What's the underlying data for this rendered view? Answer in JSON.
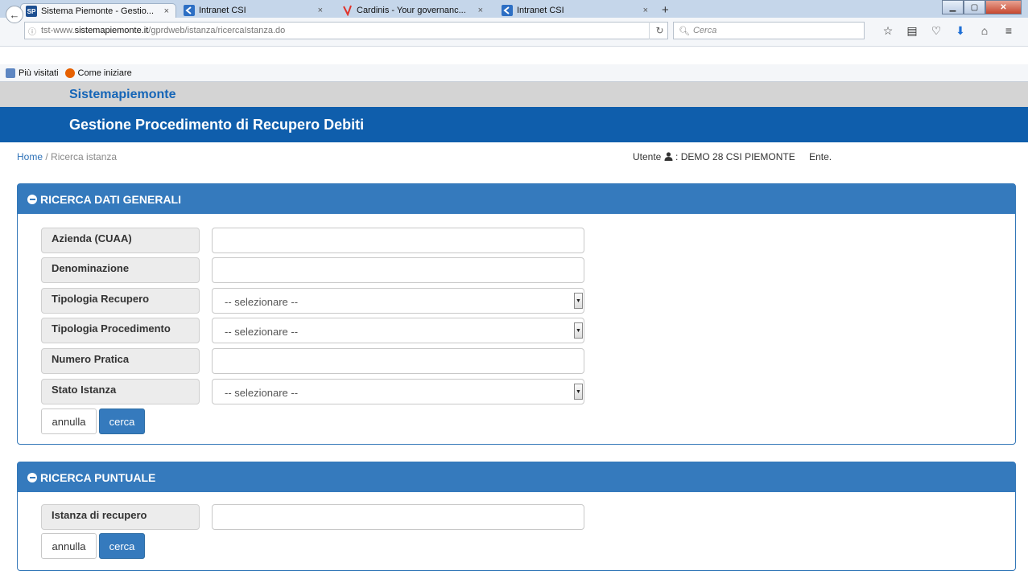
{
  "browser": {
    "tabs": [
      {
        "title": "Sistema Piemonte - Gestio...",
        "icon": "sp-favicon-icon",
        "active": true
      },
      {
        "title": "Intranet CSI",
        "icon": "csi-favicon-icon"
      },
      {
        "title": "Cardinis - Your governanc...",
        "icon": "cardinis-favicon-icon"
      },
      {
        "title": "Intranet CSI",
        "icon": "csi-favicon-icon"
      }
    ],
    "sp_badge": "SP",
    "close_glyph": "×",
    "new_tab_glyph": "+",
    "url_host": "tst-www.sistemapiemonte.it",
    "url_path": "/gprdweb/istanza/ricercaIstanza.do",
    "url_prefix": "tst-www.",
    "url_domain": "sistemapiemonte.it",
    "search_placeholder": "Cerca",
    "bookmarks": [
      {
        "label": "Più visitati"
      },
      {
        "label": "Come iniziare"
      }
    ]
  },
  "site": {
    "name": "Sistemapiemonte",
    "app_title": "Gestione Procedimento di Recupero Debiti"
  },
  "breadcrumb": {
    "home": "Home",
    "separator": "/",
    "current": "Ricerca istanza"
  },
  "user": {
    "label": "Utente",
    "name": ": DEMO 28 CSI PIEMONTE",
    "ente": "Ente."
  },
  "panel_general": {
    "title": "RICERCA DATI GENERALI",
    "fields": [
      {
        "label": "Azienda (CUAA)",
        "type": "text",
        "value": ""
      },
      {
        "label": "Denominazione",
        "type": "text",
        "value": ""
      },
      {
        "label": "Tipologia Recupero",
        "type": "select",
        "value": "-- selezionare --"
      },
      {
        "label": "Tipologia Procedimento",
        "type": "select",
        "value": "-- selezionare --"
      },
      {
        "label": "Numero Pratica",
        "type": "text",
        "value": ""
      },
      {
        "label": "Stato Istanza",
        "type": "select",
        "value": "-- selezionare --"
      }
    ],
    "cancel_label": "annulla",
    "search_label": "cerca"
  },
  "panel_specific": {
    "title": "RICERCA PUNTUALE",
    "fields": [
      {
        "label": "Istanza di recupero",
        "type": "text",
        "value": ""
      }
    ],
    "cancel_label": "annulla",
    "search_label": "cerca"
  },
  "colors": {
    "brand_blue": "#0f5eac",
    "panel_blue": "#357abd",
    "site_name_blue": "#1565b7"
  }
}
